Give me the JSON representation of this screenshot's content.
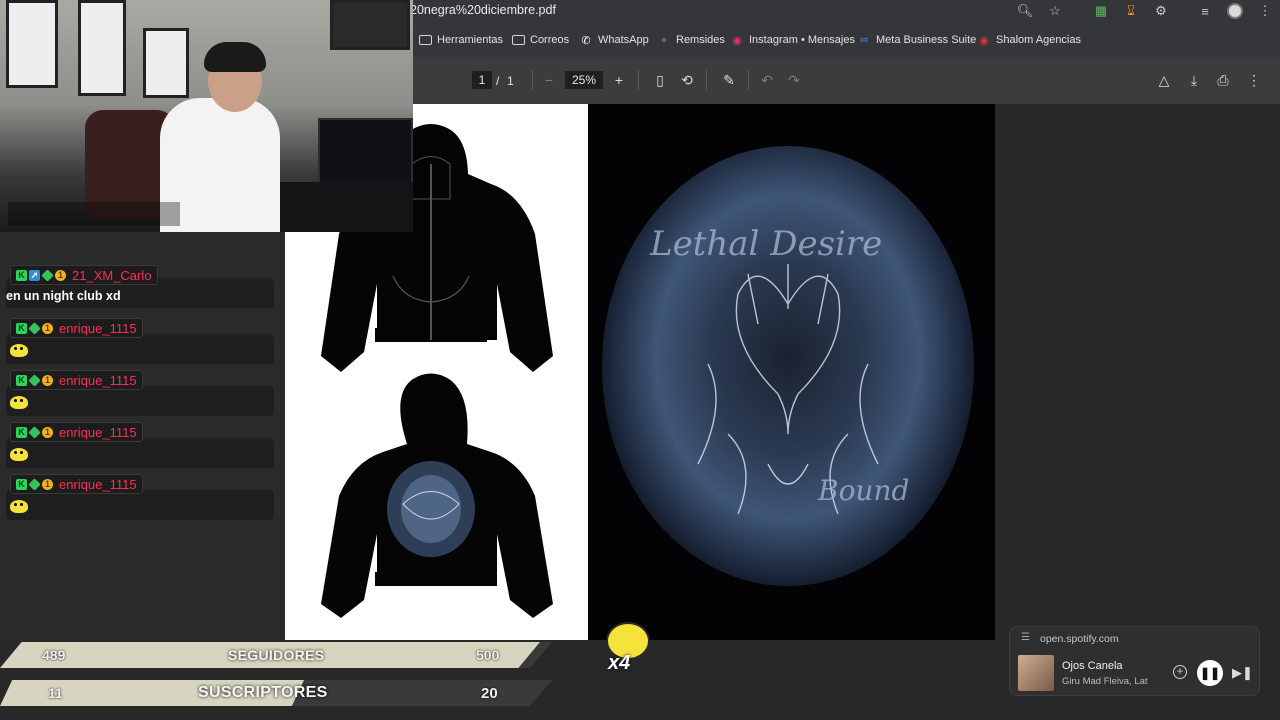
{
  "browser": {
    "url_text": "20negra%20diciembre.pdf",
    "bookmarks": [
      {
        "label": "Herramientas",
        "icon": "folder-icon"
      },
      {
        "label": "Correos",
        "icon": "folder-icon"
      },
      {
        "label": "WhatsApp",
        "icon": "whatsapp-icon"
      },
      {
        "label": "Remsides",
        "icon": "bookmark-icon"
      },
      {
        "label": "Instagram • Mensajes",
        "icon": "instagram-icon"
      },
      {
        "label": "Meta Business Suite",
        "icon": "meta-icon"
      },
      {
        "label": "Shalom Agencias",
        "icon": "shalom-icon"
      }
    ]
  },
  "pdf_toolbar": {
    "current_page": "1",
    "page_separator": "/",
    "total_pages": "1",
    "zoom": "25%",
    "zoom_out": "−",
    "zoom_in": "+"
  },
  "pdf_art": {
    "script_top": "Lethal Desire",
    "script_bottom": "Bound"
  },
  "chat": {
    "messages": [
      {
        "user": "21_XM_Carlo",
        "text": "en un night club xd"
      },
      {
        "user": "enrique_1115",
        "text": ""
      },
      {
        "user": "enrique_1115",
        "text": ""
      },
      {
        "user": "enrique_1115",
        "text": ""
      },
      {
        "user": "enrique_1115",
        "text": ""
      }
    ]
  },
  "stats": {
    "followers": {
      "current": "489",
      "label": "SEGUIDORES",
      "goal": "500",
      "progress": 0.978
    },
    "subscribers": {
      "current": "11",
      "label": "SUSCRIPTORES",
      "goal": "20",
      "progress": 0.55
    }
  },
  "alert": {
    "multiplier": "x4"
  },
  "spotify": {
    "domain": "open.spotify.com",
    "track": "Ojos Canela",
    "artist": "Giru Mad Fleiva, Late"
  },
  "colors": {
    "chat_username": "#ff2d55",
    "stat_bar": "#d7d5bf",
    "chrome_bg": "#35363a",
    "pdf_bg": "#282828"
  }
}
